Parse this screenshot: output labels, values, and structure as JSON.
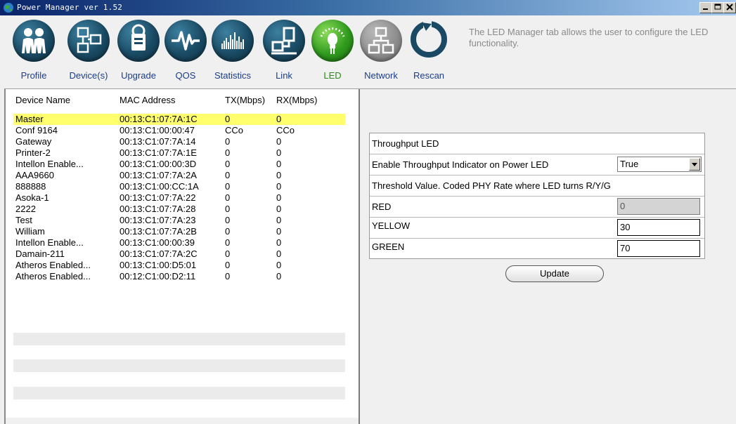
{
  "window": {
    "title": "Power Manager ver 1.52",
    "icon": "globe-icon",
    "controls": [
      "minimize",
      "maximize",
      "close"
    ]
  },
  "toolbar": {
    "items": [
      {
        "label": "Profile",
        "icon": "people-icon",
        "state": "normal"
      },
      {
        "label": "Device(s)",
        "icon": "devices-icon",
        "state": "normal"
      },
      {
        "label": "Upgrade",
        "icon": "upgrade-icon",
        "state": "normal"
      },
      {
        "label": "QOS",
        "icon": "waveform-icon",
        "state": "normal"
      },
      {
        "label": "Statistics",
        "icon": "bar-chart-icon",
        "state": "normal"
      },
      {
        "label": "Link",
        "icon": "link-icon",
        "state": "normal"
      },
      {
        "label": "LED",
        "icon": "led-bulb-icon",
        "state": "active"
      },
      {
        "label": "Network",
        "icon": "network-icon",
        "state": "disabled"
      },
      {
        "label": "Rescan",
        "icon": "rescan-icon",
        "state": "normal"
      }
    ],
    "help_text": "The LED Manager tab allows the user to configure the LED functionality."
  },
  "devices": {
    "columns": [
      "Device Name",
      "MAC Address",
      "TX(Mbps)",
      "RX(Mbps)"
    ],
    "rows": [
      {
        "name": "Master",
        "mac": "00:13:C1:07:7A:1C",
        "tx": "0",
        "rx": "0",
        "selected": true
      },
      {
        "name": "Conf 9164",
        "mac": "00:13:C1:00:00:47",
        "tx": "CCo",
        "rx": "CCo"
      },
      {
        "name": "Gateway",
        "mac": "00:13:C1:07:7A:14",
        "tx": "0",
        "rx": "0"
      },
      {
        "name": "Printer-2",
        "mac": "00:13:C1:07:7A:1E",
        "tx": "0",
        "rx": "0"
      },
      {
        "name": "Intellon Enable...",
        "mac": "00:13:C1:00:00:3D",
        "tx": "0",
        "rx": "0"
      },
      {
        "name": "AAA9660",
        "mac": "00:13:C1:07:7A:2A",
        "tx": "0",
        "rx": "0"
      },
      {
        "name": "888888",
        "mac": "00:13:C1:00:CC:1A",
        "tx": "0",
        "rx": "0"
      },
      {
        "name": "Asoka-1",
        "mac": "00:13:C1:07:7A:22",
        "tx": "0",
        "rx": "0"
      },
      {
        "name": "2222",
        "mac": "00:13:C1:07:7A:28",
        "tx": "0",
        "rx": "0"
      },
      {
        "name": "Test",
        "mac": "00:13:C1:07:7A:23",
        "tx": "0",
        "rx": "0"
      },
      {
        "name": "William",
        "mac": "00:13:C1:07:7A:2B",
        "tx": "0",
        "rx": "0"
      },
      {
        "name": "Intellon Enable...",
        "mac": "00:13:C1:00:00:39",
        "tx": "0",
        "rx": "0"
      },
      {
        "name": "Damain-211",
        "mac": "00:13:C1:07:7A:2C",
        "tx": "0",
        "rx": "0"
      },
      {
        "name": "Atheros Enabled...",
        "mac": "00:13:C1:00:D5:01",
        "tx": "0",
        "rx": "0"
      },
      {
        "name": "Atheros Enabled...",
        "mac": "00:12:C1:00:D2:11",
        "tx": "0",
        "rx": "0"
      }
    ]
  },
  "led_settings": {
    "section_title": "Throughput LED",
    "enable_label": "Enable Throughput Indicator on Power LED",
    "enable_value": "True",
    "threshold_label": "Threshold Value. Coded PHY Rate where LED turns R/Y/G",
    "red_label": "RED",
    "red_value": "0",
    "yellow_label": "YELLOW",
    "yellow_value": "30",
    "green_label": "GREEN",
    "green_value": "70",
    "update_label": "Update"
  },
  "colors": {
    "title_bar_start": "#0a246a",
    "title_bar_end": "#a6caf0",
    "icon_blue": "#1a4a63",
    "icon_active_green": "#2f9a1d",
    "label_blue": "#1a3d8a",
    "selected_row": "#ffff6e"
  }
}
